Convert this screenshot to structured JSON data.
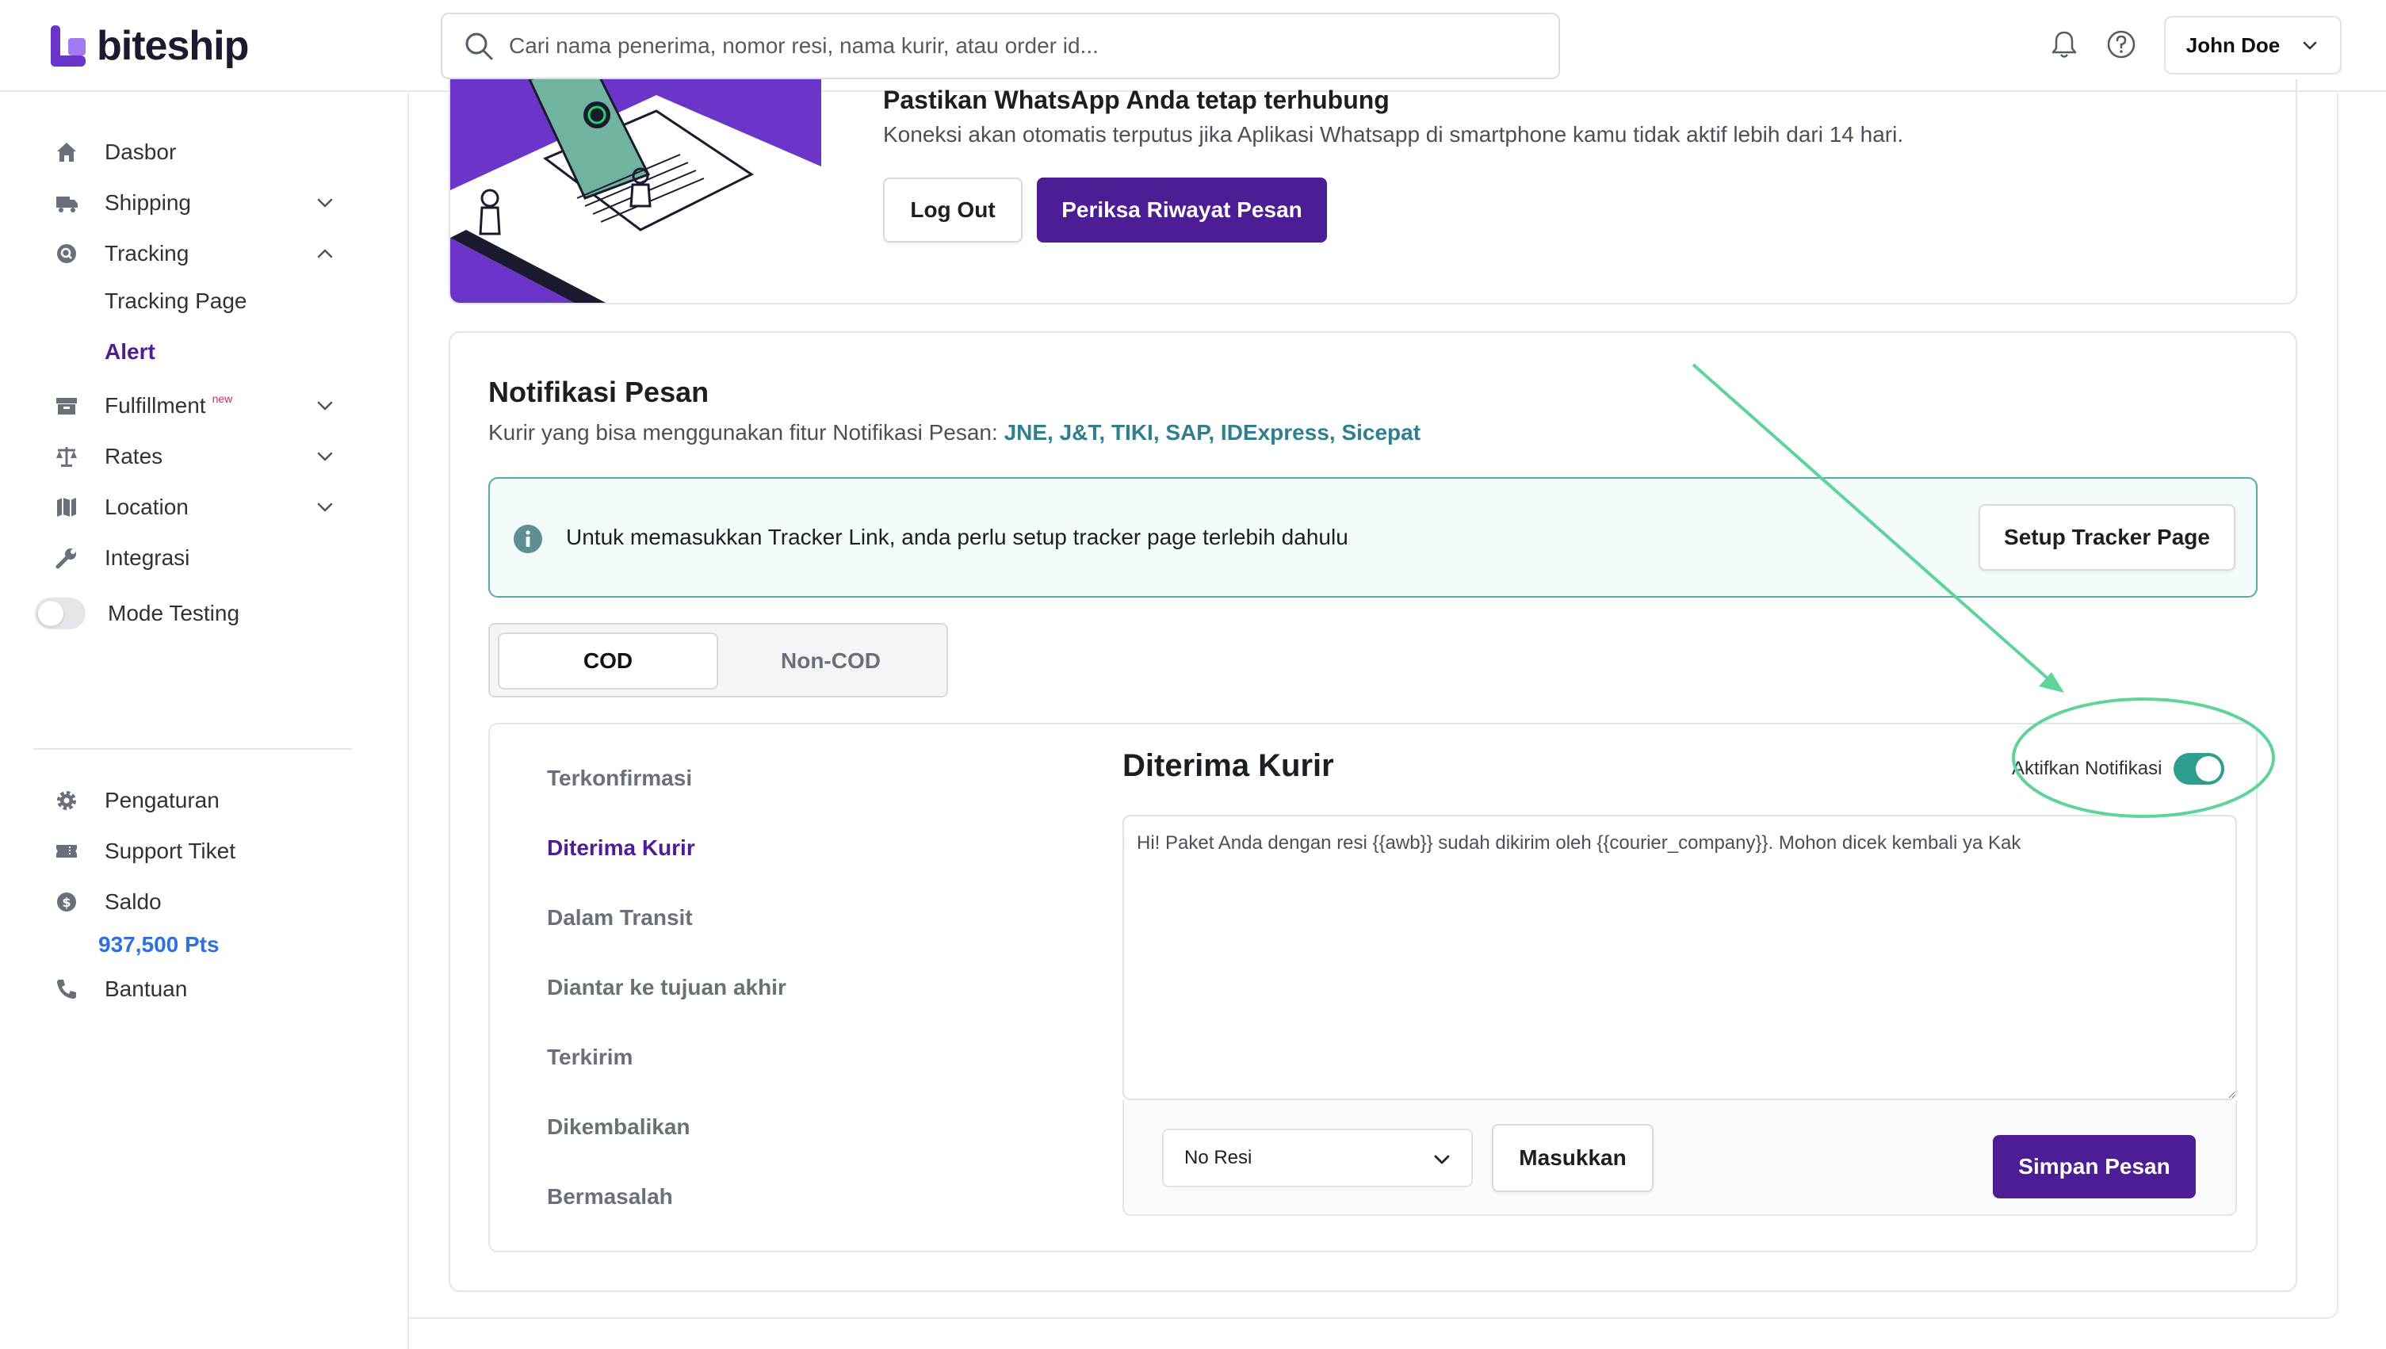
{
  "brand": {
    "name": "biteship",
    "accent": "#4c1d95",
    "teal": "#2e9f8f"
  },
  "search": {
    "placeholder": "Cari nama penerima, nomor resi, nama kurir, atau order id...",
    "icon": "search-icon"
  },
  "header": {
    "user_name": "John Doe",
    "icons": [
      "bell-icon",
      "help-icon"
    ]
  },
  "sidebar": {
    "items": [
      {
        "label": "Dasbor",
        "icon": "home-icon"
      },
      {
        "label": "Shipping",
        "icon": "truck-icon"
      },
      {
        "label": "Tracking",
        "icon": "tracking-icon"
      },
      {
        "label": "Fulfillment",
        "icon": "archive-icon",
        "badge": "new"
      },
      {
        "label": "Rates",
        "icon": "scale-icon"
      },
      {
        "label": "Location",
        "icon": "map-icon"
      },
      {
        "label": "Integrasi",
        "icon": "wrench-icon"
      },
      {
        "label": "Mode Testing"
      },
      {
        "label": "Pengaturan",
        "icon": "gear-icon"
      },
      {
        "label": "Support Tiket",
        "icon": "ticket-icon"
      },
      {
        "label": "Saldo",
        "icon": "dollar-icon"
      },
      {
        "label": "Bantuan",
        "icon": "phone-icon"
      }
    ],
    "tracking_sub": [
      "Tracking Page",
      "Alert"
    ],
    "points": "937,500 Pts"
  },
  "whatsapp": {
    "title": "Pastikan WhatsApp Anda tetap terhubung",
    "desc": "Koneksi akan otomatis terputus jika Aplikasi Whatsapp di smartphone kamu tidak aktif lebih dari 14 hari.",
    "logout": "Log Out",
    "history": "Periksa Riwayat Pesan"
  },
  "notif": {
    "title": "Notifikasi Pesan",
    "sub_prefix": "Kurir yang bisa menggunakan fitur Notifikasi Pesan:",
    "couriers": "JNE, J&T, TIKI, SAP, IDExpress, Sicepat",
    "info": "Untuk memasukkan Tracker Link, anda perlu setup tracker page terlebih dahulu",
    "setup_button": "Setup Tracker Page",
    "tabs": [
      "COD",
      "Non-COD"
    ],
    "statuses": [
      "Terkonfirmasi",
      "Diterima Kurir",
      "Dalam Transit",
      "Diantar ke tujuan akhir",
      "Terkirim",
      "Dikembalikan",
      "Bermasalah"
    ],
    "panel_title": "Diterima Kurir",
    "toggle_label": "Aktifkan Notifikasi",
    "toggle_on": true,
    "message": "Hi! Paket Anda dengan resi {{awb}} sudah dikirim oleh {{courier_company}}. Mohon dicek kembali ya Kak",
    "variable_select": "No Resi",
    "insert_button": "Masukkan",
    "save_button": "Simpan Pesan"
  }
}
